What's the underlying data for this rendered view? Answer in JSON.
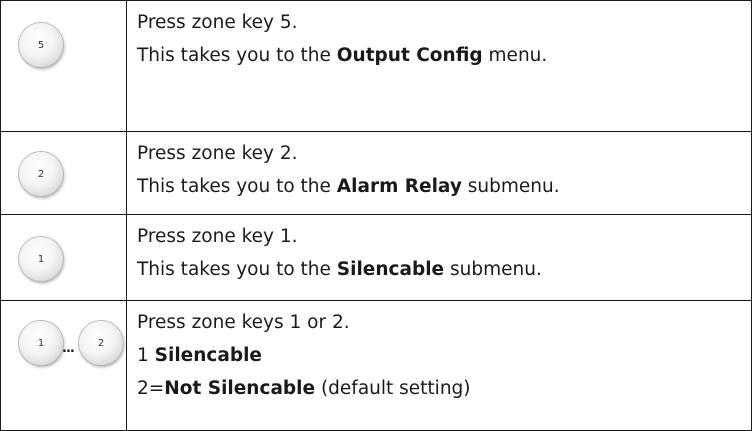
{
  "steps": [
    {
      "keys": [
        "5"
      ],
      "lines": [
        {
          "before": "Press zone key 5.",
          "bold": "",
          "after": ""
        },
        {
          "before": "This takes you to the ",
          "bold": "Output Config",
          "after": " menu."
        }
      ]
    },
    {
      "keys": [
        "2"
      ],
      "lines": [
        {
          "before": "Press zone key 2.",
          "bold": "",
          "after": ""
        },
        {
          "before": "This takes you to the ",
          "bold": "Alarm Relay",
          "after": " submenu."
        }
      ]
    },
    {
      "keys": [
        "1"
      ],
      "lines": [
        {
          "before": "Press zone key 1.",
          "bold": "",
          "after": ""
        },
        {
          "before": "This takes you to the ",
          "bold": "Silencable",
          "after": " submenu."
        }
      ]
    },
    {
      "keys": [
        "1",
        "2"
      ],
      "key_separator": "...",
      "lines": [
        {
          "before": "Press zone keys 1 or 2.",
          "bold": "",
          "after": ""
        },
        {
          "before": "1 ",
          "bold": "Silencable",
          "after": ""
        },
        {
          "before": "2=",
          "bold": "Not Silencable",
          "after": " (default setting)"
        }
      ]
    }
  ]
}
